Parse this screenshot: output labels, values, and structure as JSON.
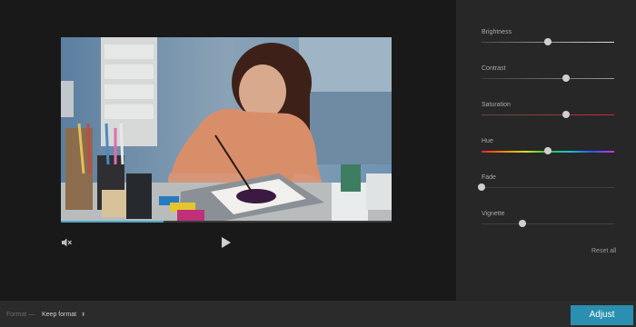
{
  "player": {
    "progress": 0.31,
    "mute_icon": "speaker-muted-icon",
    "play_icon": "play-icon"
  },
  "adjustments": [
    {
      "key": "brightness",
      "label": "Brightness",
      "value": 0.5,
      "track_color": "#555555"
    },
    {
      "key": "contrast",
      "label": "Contrast",
      "value": 0.64,
      "track_color": "#444444"
    },
    {
      "key": "saturation",
      "label": "Saturation",
      "value": 0.64,
      "track_color": "#c0392b"
    },
    {
      "key": "hue",
      "label": "Hue",
      "value": 0.5,
      "track_color": "rainbow"
    },
    {
      "key": "fade",
      "label": "Fade",
      "value": 0.0,
      "track_color": "#444444"
    },
    {
      "key": "vignette",
      "label": "Vignette",
      "value": 0.31,
      "track_color": "#444444"
    }
  ],
  "reset_label": "Reset all",
  "footer": {
    "format_label": "Format —",
    "format_value": "Keep format",
    "adjust_button": "Adjust"
  },
  "colors": {
    "accent": "#2a8fb0",
    "progress": "#4fa8c7"
  }
}
